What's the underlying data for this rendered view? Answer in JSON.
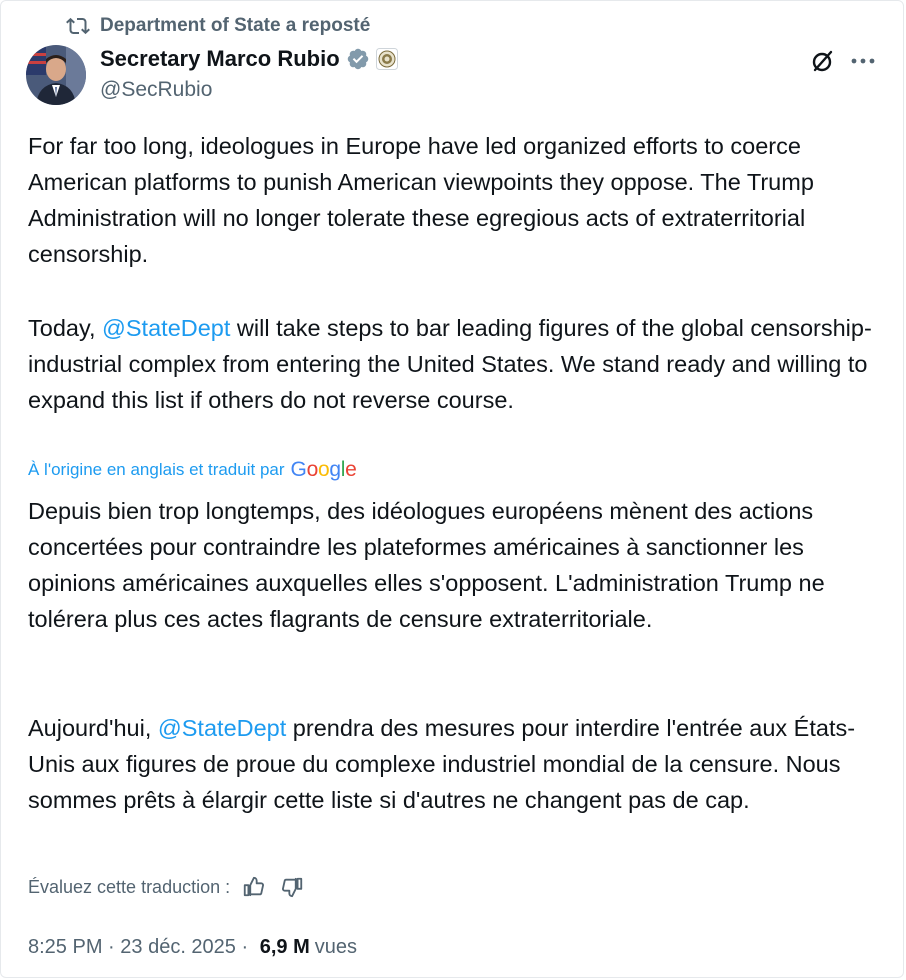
{
  "repost": {
    "icon": "repost-icon",
    "text": "Department of State a reposté"
  },
  "author": {
    "name": "Secretary Marco Rubio",
    "handle": "@SecRubio",
    "verified_icon": "verified-badge-icon",
    "affiliation_icon": "government-seal-icon",
    "verified_color": "#829aab"
  },
  "actions": {
    "grok_icon": "grok-icon",
    "more_icon": "more-icon"
  },
  "original": {
    "p1": "For far too long, ideologues in Europe have led organized efforts to coerce American platforms to punish American viewpoints they oppose. The Trump Administration will no longer tolerate these egregious acts of extraterritorial censorship.",
    "p2_before": "Today, ",
    "p2_mention": "@StateDept",
    "p2_after": " will take steps to bar leading figures of the global censorship-industrial complex from entering the United States. We stand ready and willing to expand this list if others do not reverse course."
  },
  "translation": {
    "label": "À l'origine en anglais et traduit par",
    "provider": "Google",
    "p1": "Depuis bien trop longtemps, des idéologues européens mènent des actions concertées pour contraindre les plateformes américaines à sanctionner les opinions américaines auxquelles elles s'opposent. L'administration Trump ne tolérera plus ces actes flagrants de censure extraterritoriale.",
    "p2_before": "Aujourd'hui, ",
    "p2_mention": "@StateDept",
    "p2_after": " prendra des mesures pour interdire l'entrée aux États-Unis aux figures de proue du complexe industriel mondial de la censure. Nous sommes prêts à élargir cette liste si d'autres ne changent pas de cap."
  },
  "rating": {
    "label": "Évaluez cette traduction :",
    "up_icon": "thumbs-up-icon",
    "down_icon": "thumbs-down-icon"
  },
  "meta": {
    "time": "8:25 PM",
    "sep1": " · ",
    "date": "23 déc. 2025",
    "sep2": " · ",
    "views_count": "6,9 M",
    "views_label": "vues"
  },
  "colors": {
    "link": "#1d9bf0",
    "text": "#0f1419",
    "secondary": "#536471"
  }
}
